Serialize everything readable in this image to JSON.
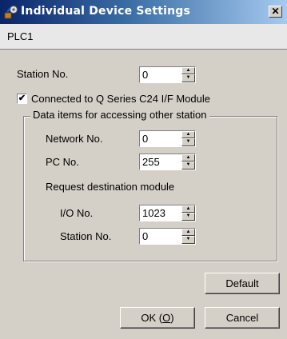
{
  "window": {
    "title": "Individual Device Settings",
    "close_glyph": "✕"
  },
  "device": {
    "name": "PLC1"
  },
  "station": {
    "label": "Station No.",
    "value": "0"
  },
  "connected": {
    "label": "Connected to Q Series C24 I/F Module",
    "checked": true,
    "check_glyph": "✔"
  },
  "group": {
    "title": "Data items for accessing other station",
    "network_label": "Network No.",
    "network_value": "0",
    "pc_label": "PC No.",
    "pc_value": "255",
    "request_label": "Request destination module",
    "io_label": "I/O No.",
    "io_value": "1023",
    "station_label": "Station No.",
    "station_value": "0"
  },
  "buttons": {
    "default": "Default",
    "ok": "OK (O)",
    "ok_prefix": "OK (",
    "ok_accel": "O",
    "ok_suffix": ")",
    "cancel": "Cancel"
  },
  "icons": {
    "app": "app-settings-icon",
    "up": "spin-up-arrow-icon",
    "down": "spin-down-arrow-icon"
  },
  "colors": {
    "titlebar_start": "#0a246a",
    "titlebar_end": "#a6caf0",
    "dialog_bg": "#d4d0c8"
  }
}
